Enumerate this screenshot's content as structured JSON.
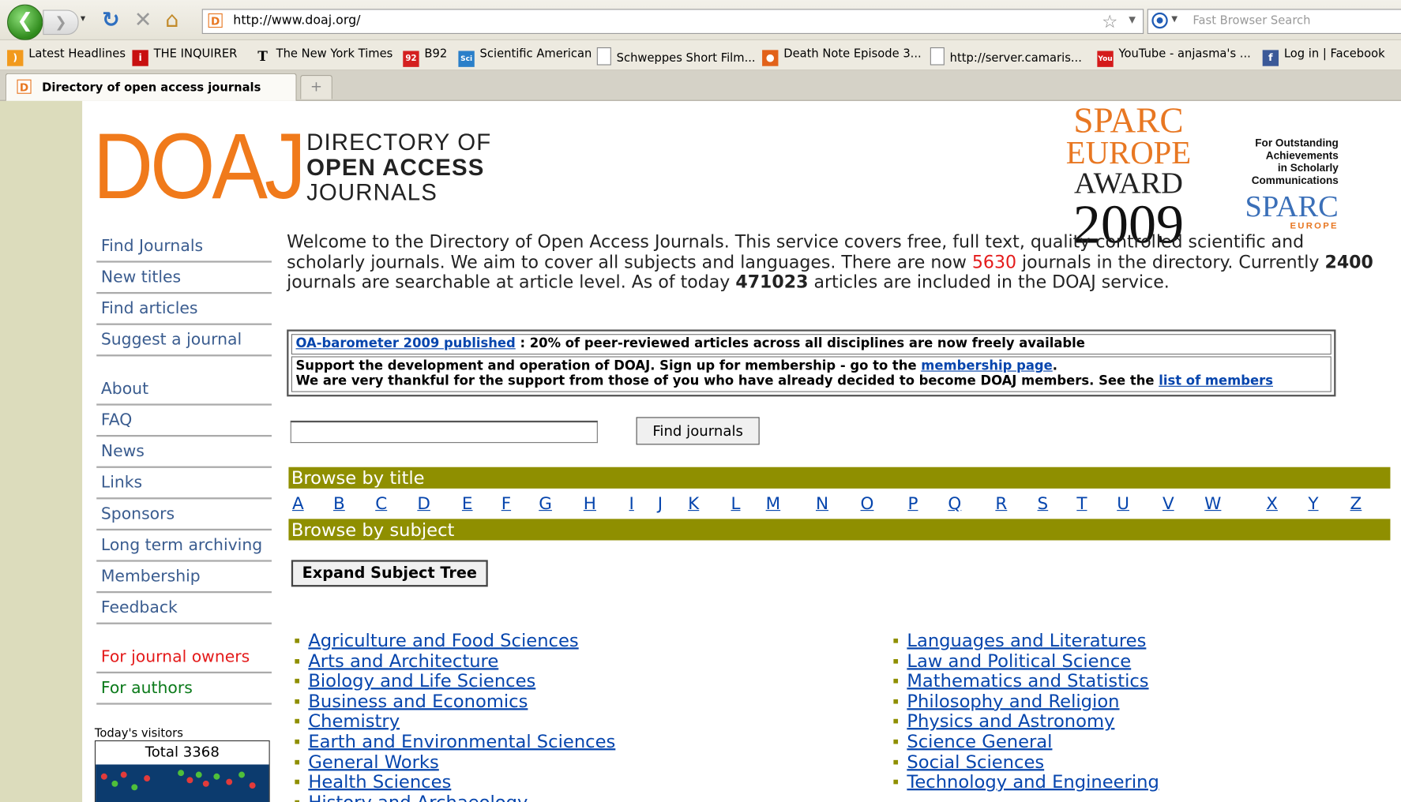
{
  "browser": {
    "url": "http://www.doaj.org/",
    "search_placeholder": "Fast Browser Search",
    "bookmarks": [
      "Latest Headlines",
      "THE INQUIRER",
      "The New York Times",
      "B92",
      "Scientific American",
      "Schweppes Short Film...",
      "Death Note Episode 3...",
      "http://server.camaris...",
      "YouTube - anjasma's ...",
      "Log in | Facebook"
    ],
    "tab_title": "Directory of open access journals",
    "new_tab_label": "+"
  },
  "header": {
    "logo": "DOAJ",
    "sub_line1": "DIRECTORY OF",
    "sub_line2": "OPEN ACCESS",
    "sub_line3": "JOURNALS",
    "award": {
      "line1": "SPARC",
      "line2": "EUROPE",
      "line3": "AWARD",
      "year": "2009",
      "side1": "For Outstanding",
      "side2": "Achievements",
      "side3": "in Scholarly",
      "side4": "Communications",
      "side_logo": "SPARC",
      "side_logo_sub": "EUROPE"
    }
  },
  "menu": {
    "group1": [
      "Find Journals",
      "New titles",
      "Find articles",
      "Suggest a journal"
    ],
    "group2": [
      "About",
      "FAQ",
      "News",
      "Links",
      "Sponsors",
      "Long term archiving",
      "Membership",
      "Feedback"
    ],
    "for_journal_owners": "For journal owners",
    "for_authors": "For authors"
  },
  "visitors": {
    "label": "Today's visitors",
    "total": "Total 3368"
  },
  "intro": {
    "part1": "Welcome to the Directory of Open Access Journals. This service covers free, full text, quality controlled scientific and scholarly journals. We aim to cover all subjects and languages. There are now ",
    "journal_count": "5630",
    "part2": " journals in the directory. Currently ",
    "searchable_count": "2400",
    "part3": " journals are searchable at article level. As of today ",
    "article_count": "471023",
    "part4": " articles are included in the DOAJ service."
  },
  "news": {
    "link1": "OA-barometer 2009 published",
    "text1": " : 20% of peer-reviewed articles across all disciplines are now freely available",
    "text2a": "Support the development and operation of DOAJ. Sign up for membership - go to the ",
    "link2": "membership page",
    "text2b": ".",
    "text3": "We are very thankful for the support from those of you who have already decided to become DOAJ members. See the ",
    "link3": "list of members"
  },
  "search": {
    "input_value": "",
    "button_label": "Find journals"
  },
  "browse_title": {
    "heading": "Browse by title",
    "letters": [
      "A",
      "B",
      "C",
      "D",
      "E",
      "F",
      "G",
      "H",
      "I",
      "J",
      "K",
      "L",
      "M",
      "N",
      "O",
      "P",
      "Q",
      "R",
      "S",
      "T",
      "U",
      "V",
      "W",
      "X",
      "Y",
      "Z"
    ]
  },
  "browse_subject": {
    "heading": "Browse by subject",
    "expand_label": "Expand Subject Tree",
    "left": [
      "Agriculture and Food Sciences",
      "Arts and Architecture",
      "Biology and Life Sciences",
      "Business and Economics",
      "Chemistry",
      "Earth and Environmental Sciences",
      "General Works",
      "Health Sciences",
      "History and Archaeology"
    ],
    "right": [
      "Languages and Literatures",
      "Law and Political Science",
      "Mathematics and Statistics",
      "Philosophy and Religion",
      "Physics and Astronomy",
      "Science General",
      "Social Sciences",
      "Technology and Engineering"
    ]
  }
}
